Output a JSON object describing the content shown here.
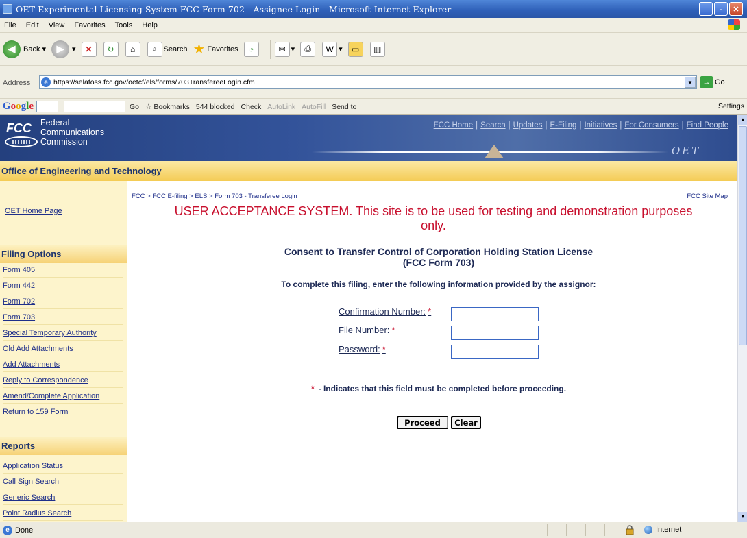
{
  "window": {
    "title": "OET Experimental Licensing System FCC Form 702 - Assignee Login - Microsoft Internet Explorer",
    "minimize": "_",
    "maximize": "▫",
    "close": "✕"
  },
  "menu": [
    "File",
    "Edit",
    "View",
    "Favorites",
    "Tools",
    "Help"
  ],
  "toolbar": {
    "back": "Back",
    "search": "Search",
    "favorites": "Favorites"
  },
  "address": {
    "label": "Address",
    "url": "https://selafoss.fcc.gov/oetcf/els/forms/703TransfereeLogin.cfm",
    "go": "Go"
  },
  "google_bar": {
    "logo": [
      "G",
      "o",
      "o",
      "g",
      "l",
      "e"
    ],
    "go": "Go",
    "bookmarks": "Bookmarks",
    "blocked": "544 blocked",
    "check": "Check",
    "autolink": "AutoLink",
    "autofill": "AutoFill",
    "send_to": "Send to",
    "settings": "Settings"
  },
  "fcc_header": {
    "logo_fcc": "FCC",
    "logo_line1": "Federal",
    "logo_line2": "Communications",
    "logo_line3": "Commission",
    "nav": [
      "FCC Home",
      "Search",
      "Updates",
      "E-Filing",
      "Initiatives",
      "For Consumers",
      "Find People"
    ],
    "oet_mark": "OET"
  },
  "office_title": "Office of Engineering and Technology",
  "sidebar": {
    "home": "OET Home Page",
    "filing_heading": "Filing Options",
    "filing_links": [
      "Form 405",
      "Form 442",
      "Form 702",
      "Form 703",
      "Special Temporary Authority",
      "Old Add Attachments",
      "Add Attachments",
      "Reply to Correspondence",
      "Amend/Complete Application",
      "Return to 159 Form"
    ],
    "reports_heading": "Reports",
    "report_links": [
      "Application Status",
      "Call Sign Search",
      "Generic Search",
      "Point Radius Search"
    ]
  },
  "breadcrumb": {
    "items": [
      "FCC",
      "FCC E-filing",
      "ELS"
    ],
    "separator": ">",
    "current": "Form 703 - Transferee Login"
  },
  "site_map": "FCC Site Map",
  "uat_notice_line1": "USER ACCEPTANCE SYSTEM. This site is to be used for testing and demonstration purposes",
  "uat_notice_line2": "only.",
  "form": {
    "title_line1": "Consent to Transfer Control of Corporation Holding Station License",
    "title_line2": "(FCC Form 703)",
    "instructions": "To complete this filing, enter the following information provided by the assignor:",
    "required_marker": "*",
    "fields": [
      {
        "label": "Confirmation Number:",
        "value": ""
      },
      {
        "label": "File Number:",
        "value": ""
      },
      {
        "label": "Password:",
        "value": ""
      }
    ],
    "required_note": "- Indicates that this field must be completed before proceeding.",
    "proceed": "Proceed",
    "clear": "Clear"
  },
  "status": {
    "text": "Done",
    "zone": "Internet"
  },
  "colors": {
    "header_blue": "#33539a",
    "office_bar_gold": "#f4cc55",
    "sidebar_cream": "#fdf4cc",
    "notice_red": "#c8102e",
    "link_blue": "#1f2f8a"
  }
}
